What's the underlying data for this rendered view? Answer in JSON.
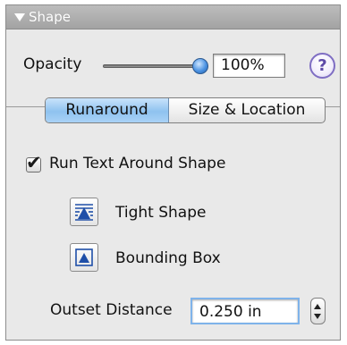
{
  "panel": {
    "title": "Shape"
  },
  "opacity": {
    "label": "Opacity",
    "value": "100%",
    "slider_fraction": 1.0
  },
  "help": {
    "glyph": "?"
  },
  "tabs": [
    {
      "label": "Runaround",
      "active": true
    },
    {
      "label": "Size & Location",
      "active": false
    }
  ],
  "runaround": {
    "checkbox_label": "Run Text Around Shape",
    "checked": true,
    "options": [
      {
        "label": "Tight Shape",
        "icon": "tight-shape-icon"
      },
      {
        "label": "Bounding Box",
        "icon": "bounding-box-icon"
      }
    ],
    "outset_label": "Outset Distance",
    "outset_value": "0.250 in"
  },
  "colors": {
    "accent_blue": "#8fc2ef",
    "panel_bg": "#e9e9e9",
    "header_bg": "#a9a9a9",
    "icon_blue": "#1f4fa8"
  }
}
